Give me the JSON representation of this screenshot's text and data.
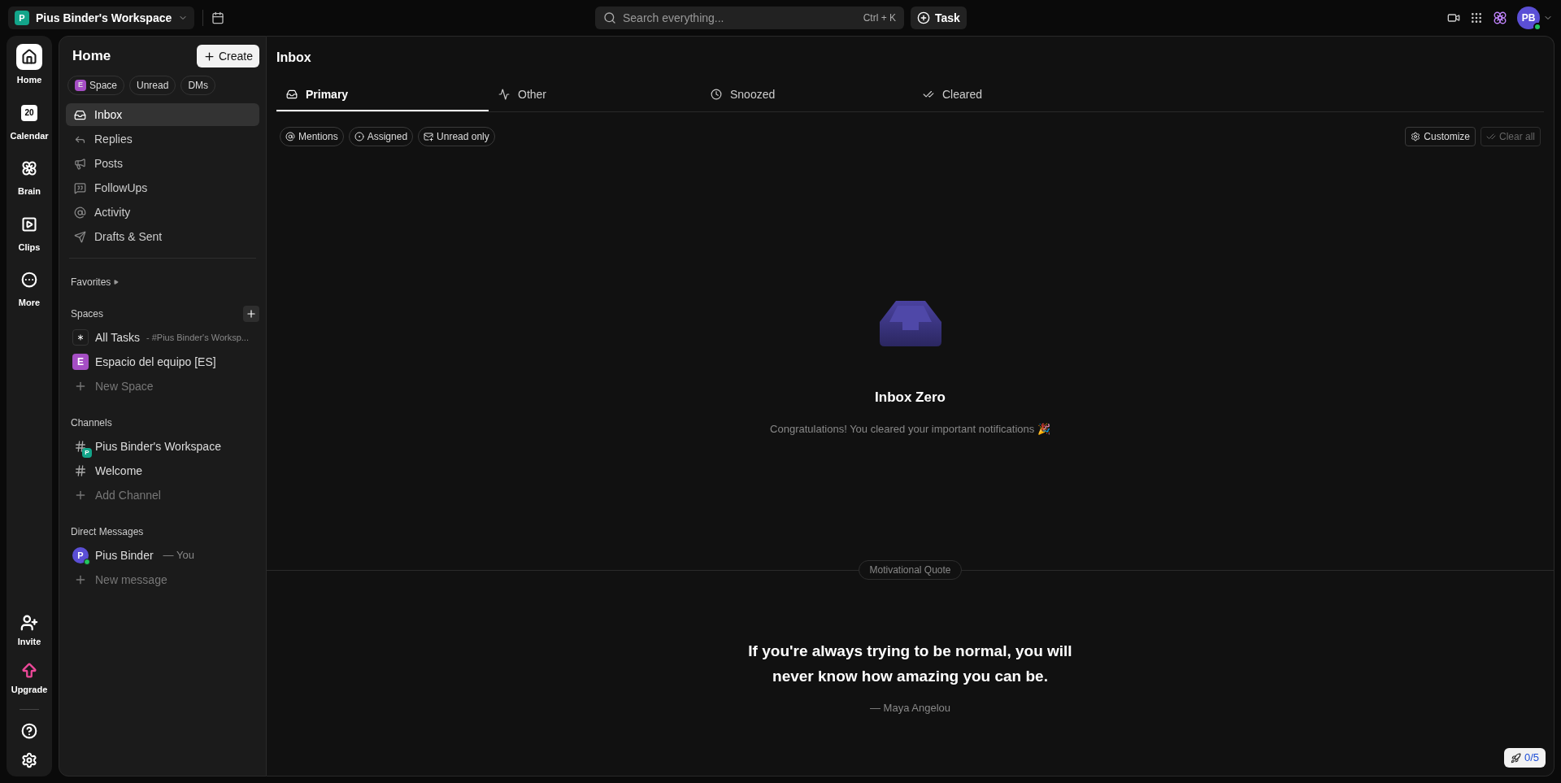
{
  "topbar": {
    "workspace_initial": "P",
    "workspace_name": "Pius Binder's Workspace",
    "search_placeholder": "Search everything...",
    "search_shortcut": "Ctrl + K",
    "task_button": "Task",
    "avatar": "PB"
  },
  "rail": {
    "items": [
      {
        "kind": "home",
        "label": "Home",
        "selected": true
      },
      {
        "kind": "calendar",
        "label": "Calendar",
        "day": "20",
        "selected": false
      },
      {
        "kind": "brain",
        "label": "Brain",
        "selected": false
      },
      {
        "kind": "clips",
        "label": "Clips",
        "selected": false
      },
      {
        "kind": "more",
        "label": "More",
        "selected": false
      }
    ],
    "bottom": [
      {
        "kind": "invite",
        "label": "Invite"
      },
      {
        "kind": "upgrade",
        "label": "Upgrade"
      }
    ],
    "utility": [
      {
        "kind": "help"
      },
      {
        "kind": "settings"
      }
    ]
  },
  "sidebar": {
    "title": "Home",
    "create_button": "Create",
    "filters": [
      {
        "label": "Space",
        "badge": "E"
      },
      {
        "label": "Unread"
      },
      {
        "label": "DMs"
      }
    ],
    "nav": [
      {
        "kind": "inbox",
        "label": "Inbox",
        "selected": true
      },
      {
        "kind": "replies",
        "label": "Replies",
        "selected": false
      },
      {
        "kind": "posts",
        "label": "Posts",
        "selected": false
      },
      {
        "kind": "followups",
        "label": "FollowUps",
        "selected": false
      },
      {
        "kind": "activity",
        "label": "Activity",
        "selected": false
      },
      {
        "kind": "drafts",
        "label": "Drafts & Sent",
        "selected": false
      }
    ],
    "favorites": "Favorites",
    "sections": [
      {
        "title": "Spaces",
        "add_button": true,
        "items": [
          {
            "kind": "all",
            "label": "All Tasks",
            "suffix": "- #Pius Binder's Worksp..."
          },
          {
            "kind": "space",
            "label": "Espacio del equipo [ES]",
            "badge": "E",
            "color": "#a54ec4"
          },
          {
            "kind": "add",
            "label": "New Space"
          }
        ]
      },
      {
        "title": "Channels",
        "add_button": false,
        "items": [
          {
            "kind": "channel",
            "label": "Pius Binder's Workspace",
            "badge": "P",
            "color": "#13a58a"
          },
          {
            "kind": "channel",
            "label": "Welcome"
          },
          {
            "kind": "add",
            "label": "Add Channel"
          }
        ]
      },
      {
        "title": "Direct Messages",
        "add_button": false,
        "items": [
          {
            "kind": "person",
            "label": "Pius Binder",
            "badge": "P",
            "suffix": "— You",
            "color": "#5b4fd6"
          },
          {
            "kind": "add",
            "label": "New message"
          }
        ]
      }
    ]
  },
  "main": {
    "title": "Inbox",
    "tabs": [
      {
        "kind": "primary",
        "label": "Primary",
        "selected": true
      },
      {
        "kind": "other",
        "label": "Other",
        "selected": false
      },
      {
        "kind": "snoozed",
        "label": "Snoozed",
        "selected": false
      },
      {
        "kind": "cleared",
        "label": "Cleared",
        "selected": false
      }
    ],
    "chips": [
      {
        "kind": "mentions",
        "label": "Mentions"
      },
      {
        "kind": "assigned",
        "label": "Assigned"
      },
      {
        "kind": "unread",
        "label": "Unread only"
      }
    ],
    "customize": {
      "label": "Customize",
      "disabled": false
    },
    "clear_all": {
      "label": "Clear all",
      "disabled": true
    },
    "empty_title": "Inbox Zero",
    "empty_text": "Congratulations! You cleared your important notifications 🎉",
    "divider_label": "Motivational Quote",
    "quote": "If you're always trying to be normal, you will never know how amazing you can be.",
    "author": "— Maya Angelou",
    "progress": "0/5"
  }
}
